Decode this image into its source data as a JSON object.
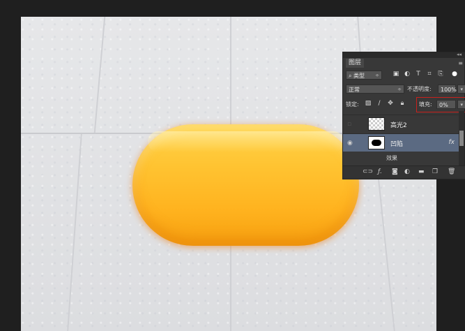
{
  "layers_panel": {
    "tab_label": "图层",
    "filter_type": "类型",
    "blend_mode": "正常",
    "opacity_label": "不透明度:",
    "opacity_value": "100%",
    "lock_label": "锁定:",
    "fill_label": "填充:",
    "fill_value": "0%",
    "layers": [
      {
        "name": "高光2",
        "visible": false,
        "selected": false,
        "has_fx": false
      },
      {
        "name": "凹陷",
        "visible": true,
        "selected": true,
        "has_fx": true
      }
    ],
    "effects_label": "效果",
    "fx_glyph": "fx"
  },
  "colors": {
    "soap_top": "#ffd44a",
    "soap_bottom": "#f7a00f",
    "selected_layer": "#5b6a82",
    "fill_highlight_border": "#c9201c"
  }
}
